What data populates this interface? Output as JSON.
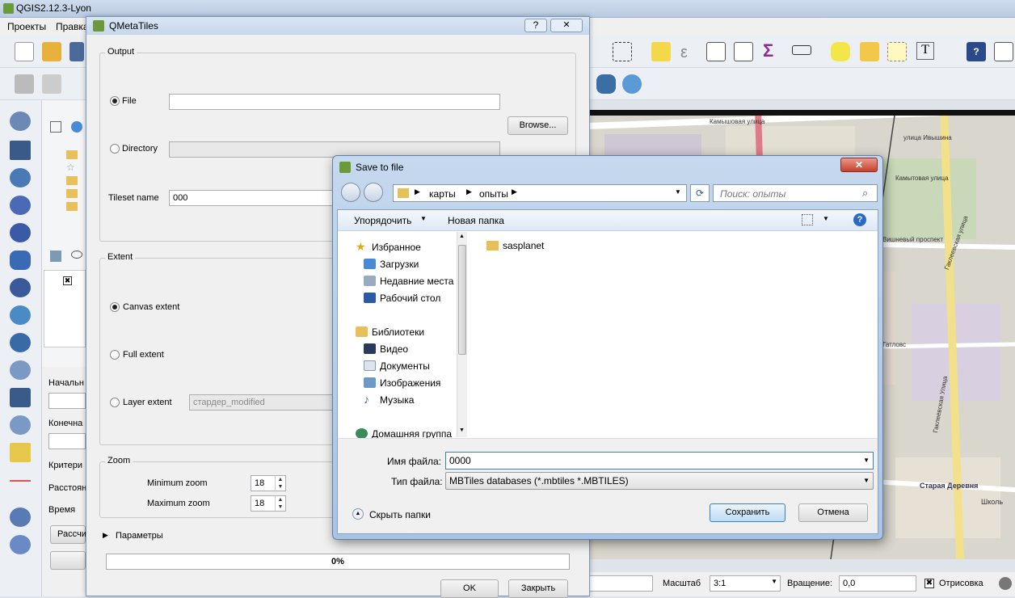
{
  "app": {
    "title": "QGIS2.12.3-Lyon",
    "menu": [
      "Проекты",
      "Правка"
    ]
  },
  "status": {
    "scale_label": "Масштаб",
    "scale_value": "3:1",
    "rotation_label": "Вращение:",
    "rotation_value": "0,0",
    "render_label": "Отрисовка"
  },
  "layers_panel": {
    "labels": [
      "Начальн",
      "Конечна",
      "Критери",
      "Расстоян",
      "Время"
    ],
    "button": "Рассчи"
  },
  "map": {
    "labels": [
      "Камышовая улица",
      "улица Ивышина",
      "Камытовая улица",
      "Гаклеевская улица",
      "Вишневый проспект",
      "Гатловс",
      "Гаклеевская Улица",
      "Старая Деревня",
      "Школь"
    ]
  },
  "qmetatiles": {
    "title": "QMetaTiles",
    "help": "?",
    "close": "✕",
    "output_group": "Output",
    "file_label": "File",
    "file_value": "",
    "browse": "Browse...",
    "directory_label": "Directory",
    "directory_value": "",
    "tileset_label": "Tileset name",
    "tileset_value": "000",
    "extent_group": "Extent",
    "canvas_extent": "Canvas extent",
    "full_extent": "Full extent",
    "layer_extent": "Layer extent",
    "layer_value": "стардер_modified",
    "zoom_group": "Zoom",
    "min_zoom_label": "Minimum zoom",
    "min_zoom": "18",
    "max_zoom_label": "Maximum zoom",
    "max_zoom": "18",
    "params": "Параметры",
    "progress_text": "0%",
    "progress": 0.0,
    "ok": "OK",
    "close_btn": "Закрыть"
  },
  "save_dialog": {
    "title": "Save to file",
    "close": "✕",
    "breadcrumb": [
      "карты",
      "опыты"
    ],
    "search_placeholder": "Поиск: опыты",
    "organize": "Упорядочить",
    "new_folder": "Новая папка",
    "nav": {
      "favorites": "Избранное",
      "fav_items": [
        "Загрузки",
        "Недавние места",
        "Рабочий стол"
      ],
      "libraries": "Библиотеки",
      "lib_items": [
        "Видео",
        "Документы",
        "Изображения",
        "Музыка"
      ],
      "homegroup": "Домашняя группа"
    },
    "files": [
      "sasplanet"
    ],
    "filename_label": "Имя файла:",
    "filename_value": "0000",
    "filetype_label": "Тип файла:",
    "filetype_value": "MBTiles databases (*.mbtiles *.MBTILES)",
    "hide_folders": "Скрыть папки",
    "save_btn": "Сохранить",
    "cancel_btn": "Отмена"
  }
}
